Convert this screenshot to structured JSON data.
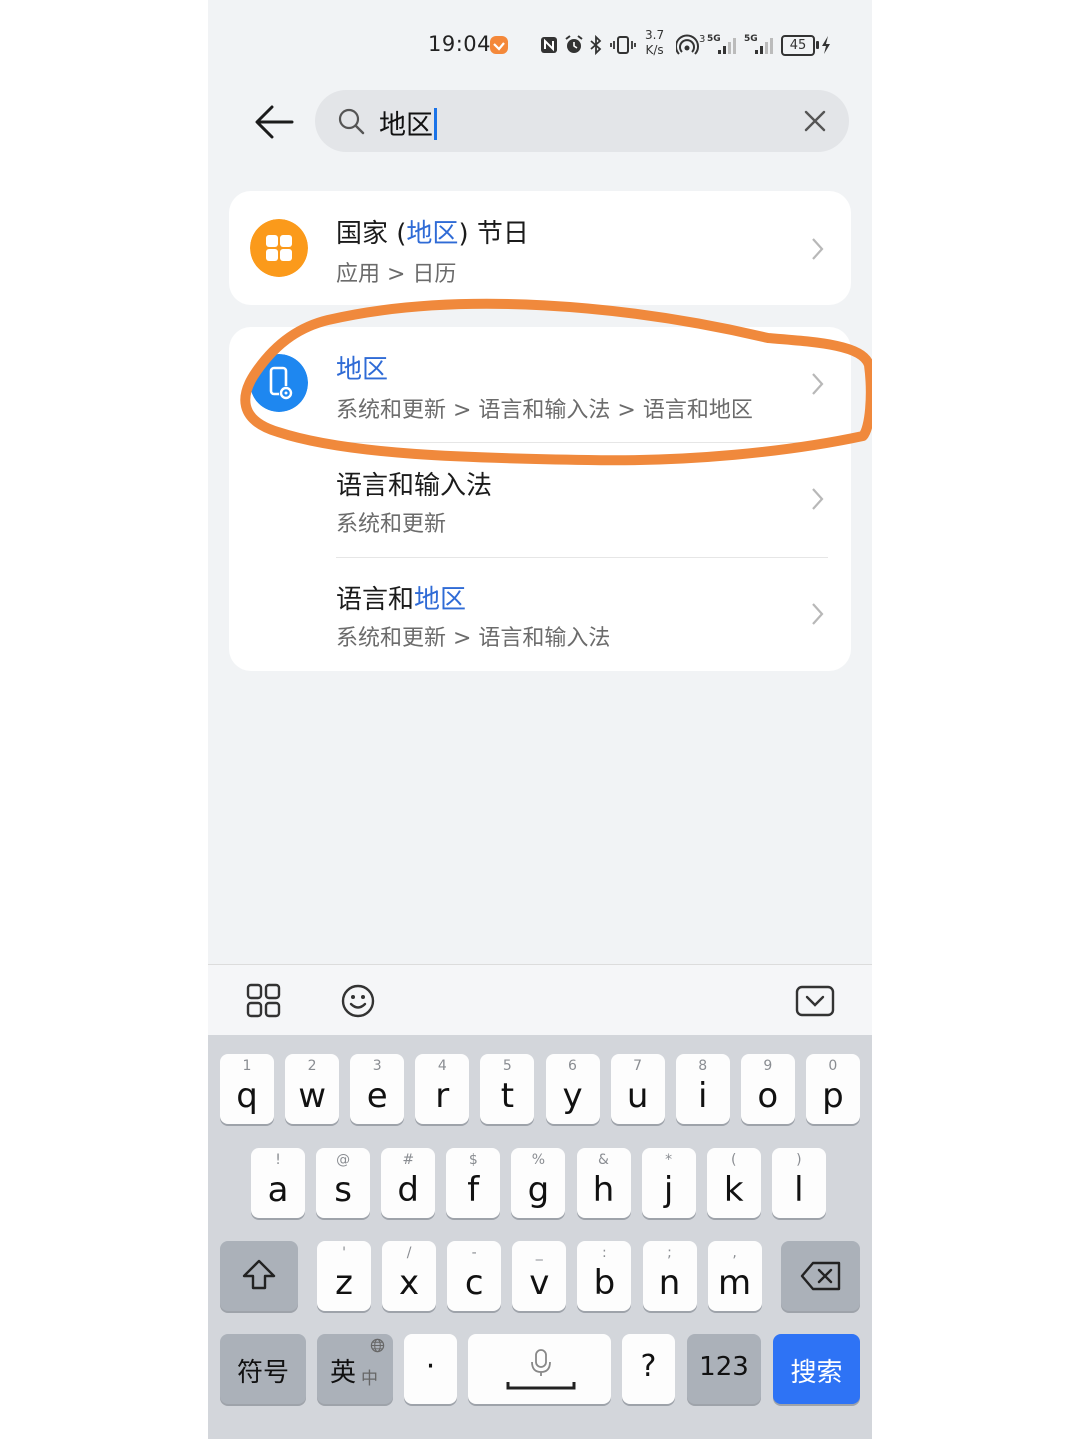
{
  "status_bar": {
    "time": "19:04",
    "net_speed_value": "3.7",
    "net_speed_unit": "K/s",
    "sim1": "5G",
    "sim2": "5G",
    "wifi_badge": "3",
    "battery": "45",
    "icons": [
      "notification-app-icon",
      "nfc-icon",
      "alarm-icon",
      "bluetooth-icon",
      "vibrate-icon",
      "hotspot-icon",
      "signal-icon",
      "charging-icon"
    ]
  },
  "search": {
    "query": "地区",
    "icons": [
      "back-arrow-icon",
      "search-icon",
      "clear-icon"
    ]
  },
  "results": {
    "r1": {
      "title_pre": "国家 (",
      "title_hl": "地区",
      "title_post": ") 节日",
      "path": "应用 > 日历",
      "icon": "calendar-app-icon"
    },
    "r2": {
      "title_hl": "地区",
      "path": "系统和更新 > 语言和输入法 > 语言和地区",
      "icon": "system-settings-icon"
    },
    "r3": {
      "title": "语言和输入法",
      "path": "系统和更新"
    },
    "r4": {
      "title_pre": "语言和",
      "title_hl": "地区",
      "path": "系统和更新 > 语言和输入法"
    }
  },
  "colors": {
    "highlight": "#2f6bd6",
    "annotation": "#f0893c",
    "calendar_icon": "#fb9a1b",
    "settings_icon": "#1e87f0",
    "search_key": "#2e73f5"
  },
  "keyboard": {
    "row1": [
      {
        "hint": "1",
        "ch": "q"
      },
      {
        "hint": "2",
        "ch": "w"
      },
      {
        "hint": "3",
        "ch": "e"
      },
      {
        "hint": "4",
        "ch": "r"
      },
      {
        "hint": "5",
        "ch": "t"
      },
      {
        "hint": "6",
        "ch": "y"
      },
      {
        "hint": "7",
        "ch": "u"
      },
      {
        "hint": "8",
        "ch": "i"
      },
      {
        "hint": "9",
        "ch": "o"
      },
      {
        "hint": "0",
        "ch": "p"
      }
    ],
    "row2": [
      {
        "hint": "!",
        "ch": "a"
      },
      {
        "hint": "@",
        "ch": "s"
      },
      {
        "hint": "#",
        "ch": "d"
      },
      {
        "hint": "$",
        "ch": "f"
      },
      {
        "hint": "%",
        "ch": "g"
      },
      {
        "hint": "&",
        "ch": "h"
      },
      {
        "hint": "*",
        "ch": "j"
      },
      {
        "hint": "(",
        "ch": "k"
      },
      {
        "hint": ")",
        "ch": "l"
      }
    ],
    "row3": [
      {
        "hint": "'",
        "ch": "z"
      },
      {
        "hint": "/",
        "ch": "x"
      },
      {
        "hint": "-",
        "ch": "c"
      },
      {
        "hint": "_",
        "ch": "v"
      },
      {
        "hint": ":",
        "ch": "b"
      },
      {
        "hint": ";",
        "ch": "n"
      },
      {
        "hint": ",",
        "ch": "m"
      }
    ],
    "symbols": "符号",
    "lang_main": "英",
    "lang_alt": "中",
    "dot": "·",
    "question": "?",
    "numbers": "123",
    "search": "搜索",
    "toolbar_icons": [
      "grid-icon",
      "emoji-icon",
      "hide-keyboard-icon"
    ]
  }
}
